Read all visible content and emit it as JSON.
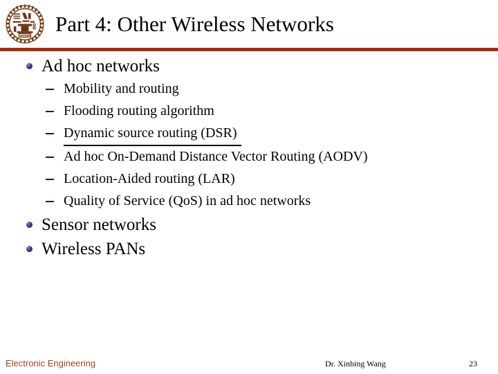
{
  "slide": {
    "title": "Part 4: Other Wireless Networks",
    "logo_icon": "university-seal-icon",
    "accent_color": "#9C3314",
    "bullet_color": "#2f2d78",
    "footer_left_color": "#A14424"
  },
  "content": {
    "items": [
      {
        "level": 1,
        "text": "Ad hoc networks",
        "bullet_icon": "sphere-bullet-icon"
      },
      {
        "level": 2,
        "text": "Mobility and routing",
        "bullet_icon": "dash-bullet-icon",
        "underlined": false
      },
      {
        "level": 2,
        "text": "Flooding routing algorithm",
        "bullet_icon": "dash-bullet-icon",
        "underlined": false
      },
      {
        "level": 2,
        "text": "Dynamic source routing (DSR)",
        "bullet_icon": "dash-bullet-icon",
        "underlined": true
      },
      {
        "level": 2,
        "text": "Ad hoc On-Demand Distance Vector Routing (AODV)",
        "bullet_icon": "dash-bullet-icon",
        "underlined": false
      },
      {
        "level": 2,
        "text": "Location-Aided routing (LAR)",
        "bullet_icon": "dash-bullet-icon",
        "underlined": false
      },
      {
        "level": 2,
        "text": "Quality of Service (QoS) in ad hoc networks",
        "bullet_icon": "dash-bullet-icon",
        "underlined": false
      },
      {
        "level": 1,
        "text": "Sensor networks",
        "bullet_icon": "sphere-bullet-icon"
      },
      {
        "level": 1,
        "text": "Wireless PANs",
        "bullet_icon": "sphere-bullet-icon"
      }
    ]
  },
  "footer": {
    "department": "Electronic Engineering",
    "author": "Dr. Xinbing Wang",
    "page_number": "23"
  }
}
